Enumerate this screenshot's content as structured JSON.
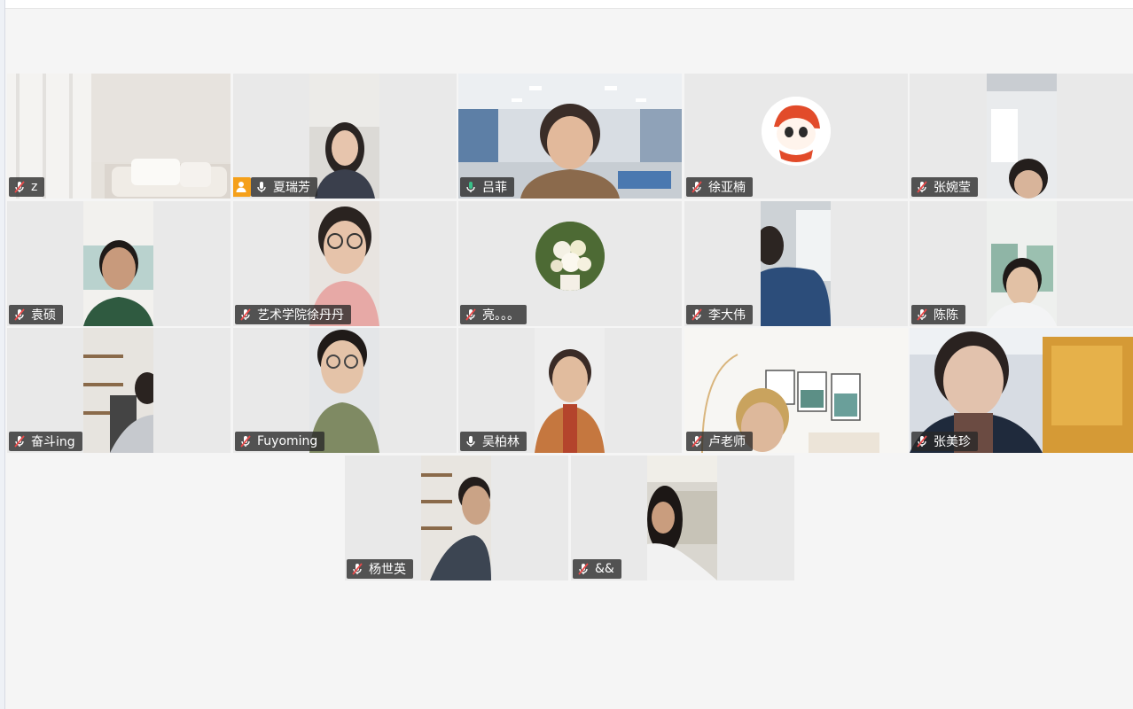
{
  "participants": [
    {
      "name": "z",
      "mic": "muted"
    },
    {
      "name": "夏瑞芳",
      "mic": "on",
      "role": "host"
    },
    {
      "name": "吕菲",
      "mic": "speaking"
    },
    {
      "name": "徐亚楠",
      "mic": "muted"
    },
    {
      "name": "张婉莹",
      "mic": "muted"
    },
    {
      "name": "袁硕",
      "mic": "muted"
    },
    {
      "name": "艺术学院徐丹丹",
      "mic": "muted"
    },
    {
      "name": "亮。。。",
      "mic": "muted"
    },
    {
      "name": "李大伟",
      "mic": "muted"
    },
    {
      "name": "陈陈",
      "mic": "muted"
    },
    {
      "name": "奋斗ing",
      "mic": "muted"
    },
    {
      "name": "Fuyoming",
      "mic": "muted"
    },
    {
      "name": "吴柏林",
      "mic": "on"
    },
    {
      "name": "卢老师",
      "mic": "muted"
    },
    {
      "name": "张美珍",
      "mic": "muted"
    },
    {
      "name": "杨世英",
      "mic": "muted"
    },
    {
      "name": "&&",
      "mic": "muted"
    }
  ],
  "colors": {
    "active_speaker_border": "#39c089",
    "host_badge": "#f5a01a",
    "label_bg": "#282828"
  }
}
